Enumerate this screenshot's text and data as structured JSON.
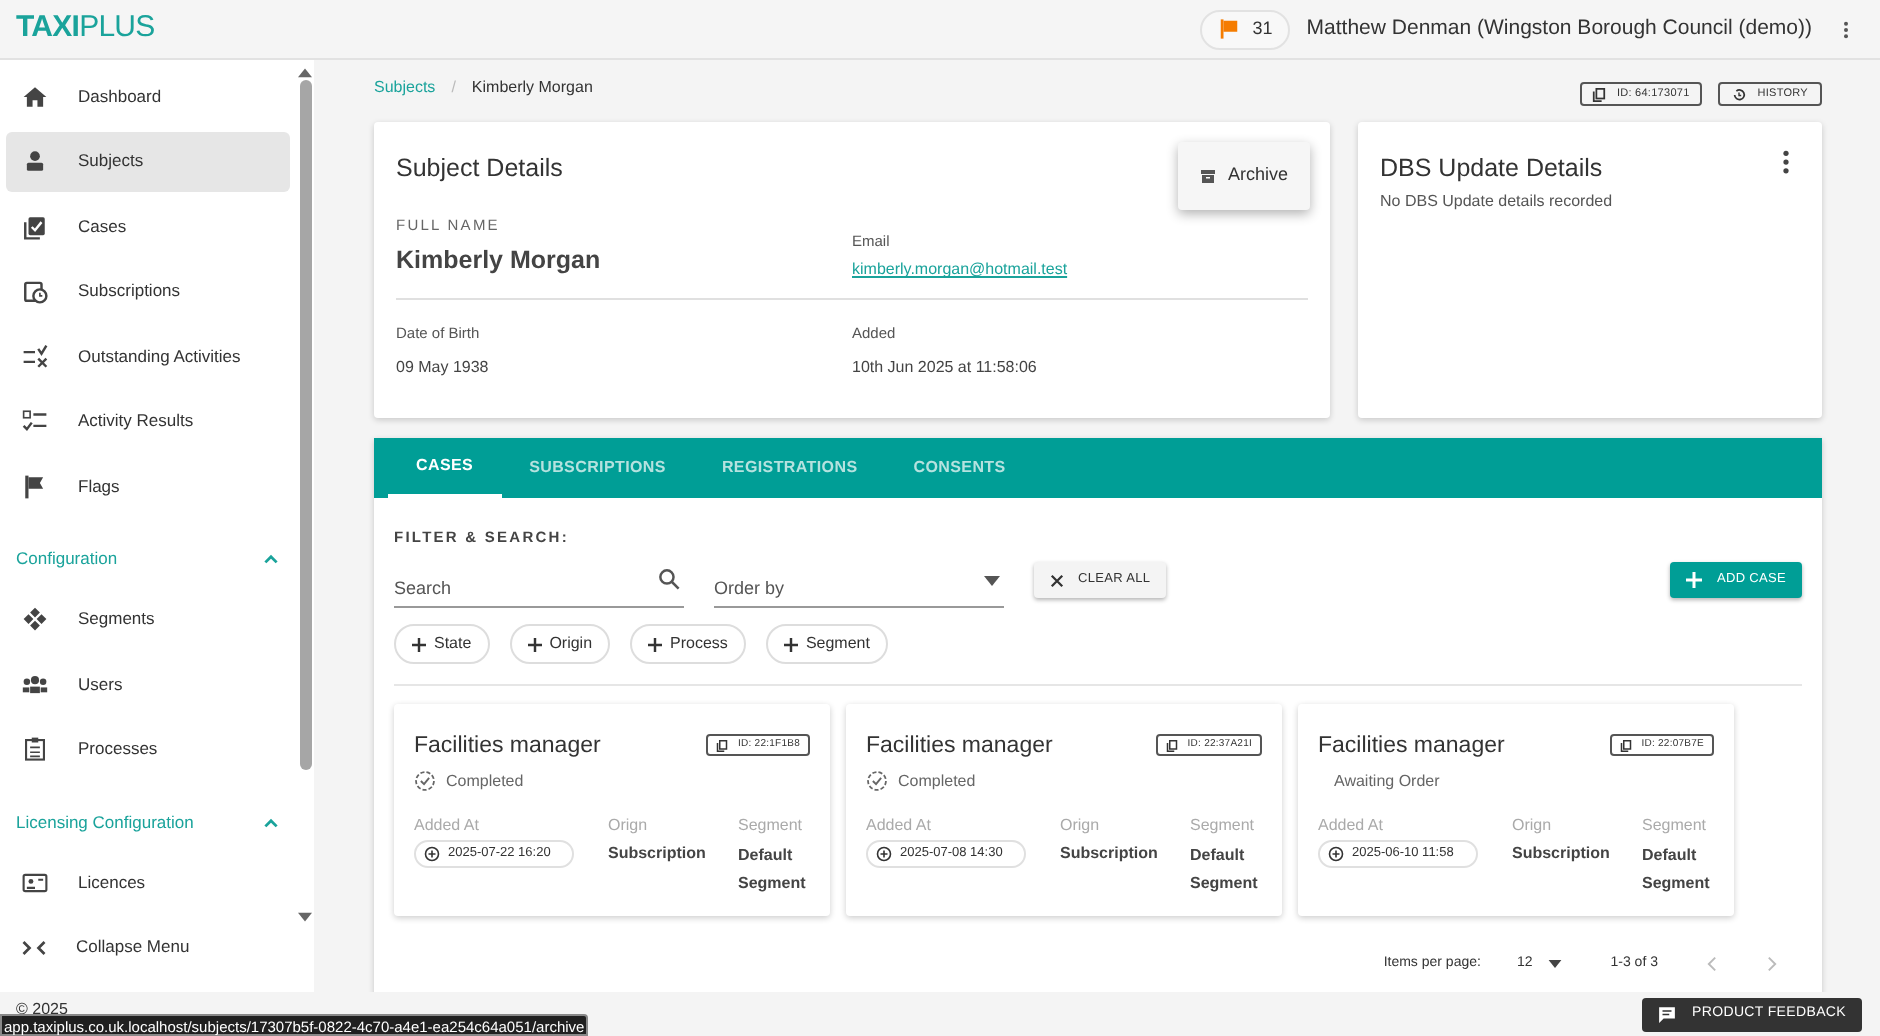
{
  "header": {
    "logo_left": "TA",
    "logo_mid": "XI",
    "logo_right": "PLUS",
    "flag_count": "31",
    "user": "Matthew Denman (Wingston Borough Council (demo))"
  },
  "sidebar": {
    "items": [
      {
        "label": "Dashboard",
        "selected": false
      },
      {
        "label": "Subjects",
        "selected": true
      },
      {
        "label": "Cases",
        "selected": false
      },
      {
        "label": "Subscriptions",
        "selected": false
      },
      {
        "label": "Outstanding Activities",
        "selected": false
      },
      {
        "label": "Activity Results",
        "selected": false
      },
      {
        "label": "Flags",
        "selected": false
      }
    ],
    "sections": [
      {
        "title": "Configuration",
        "expanded": true,
        "items": [
          {
            "label": "Segments",
            "selected": false
          },
          {
            "label": "Users",
            "selected": false
          },
          {
            "label": "Processes",
            "selected": false
          }
        ]
      },
      {
        "title": "Licensing Configuration",
        "expanded": true,
        "items": [
          {
            "label": "Licences",
            "selected": false
          }
        ]
      }
    ],
    "collapse": "Collapse Menu",
    "copyright": "© 2025"
  },
  "breadcrumb": {
    "parent": "Subjects",
    "separator": "/",
    "current": "Kimberly Morgan"
  },
  "id_button": "ID: 64:173071",
  "history_button": "HISTORY",
  "subject": {
    "title": "Subject Details",
    "full_name_label": "FULL NAME",
    "full_name": "Kimberly Morgan",
    "email_label": "Email",
    "email": "kimberly.morgan@hotmail.test",
    "dob_label": "Date of Birth",
    "dob": "09 May 1938",
    "added_label": "Added",
    "added": "10th Jun 2025 at 11:58:06"
  },
  "menu": {
    "items": [
      "Archive"
    ]
  },
  "dbs": {
    "title": "DBS Update Details",
    "message": "No DBS Update details recorded"
  },
  "tabs": [
    {
      "label": "CASES",
      "selected": true
    },
    {
      "label": "SUBSCRIPTIONS",
      "selected": false
    },
    {
      "label": "REGISTRATIONS",
      "selected": false
    },
    {
      "label": "CONSENTS",
      "selected": false
    }
  ],
  "filter": {
    "title": "FILTER & SEARCH:",
    "search_placeholder": "Search",
    "order_placeholder": "Order by",
    "clear": "CLEAR ALL",
    "add": "ADD CASE",
    "chips": [
      "State",
      "Origin",
      "Process",
      "Segment"
    ]
  },
  "cases": [
    {
      "title": "Facilities manager",
      "id": "ID: 22:1F1B8",
      "kind": "completed",
      "status": "Completed",
      "added_label": "Added At",
      "added": "2025-07-22 16:20",
      "origin_label": "Orign",
      "origin": "Subscription",
      "segment_label": "Segment",
      "segment": "Default Segment"
    },
    {
      "title": "Facilities manager",
      "id": "ID: 22:37A21I",
      "kind": "completed",
      "status": "Completed",
      "added_label": "Added At",
      "added": "2025-07-08 14:30",
      "origin_label": "Orign",
      "origin": "Subscription",
      "segment_label": "Segment",
      "segment": "Default Segment"
    },
    {
      "title": "Facilities manager",
      "id": "ID: 22:07B7E",
      "kind": "awaiting",
      "status": "Awaiting Order",
      "added_label": "Added At",
      "added": "2025-06-10 11:58",
      "origin_label": "Orign",
      "origin": "Subscription",
      "segment_label": "Segment",
      "segment": "Default Segment"
    }
  ],
  "pagination": {
    "label": "Items per page:",
    "size": "12",
    "range": "1-3 of 3"
  },
  "status_url": "app.taxiplus.co.uk.localhost/subjects/17307b5f-0822-4c70-a4e1-ea254c64a051/archive",
  "feedback": "PRODUCT FEEDBACK"
}
